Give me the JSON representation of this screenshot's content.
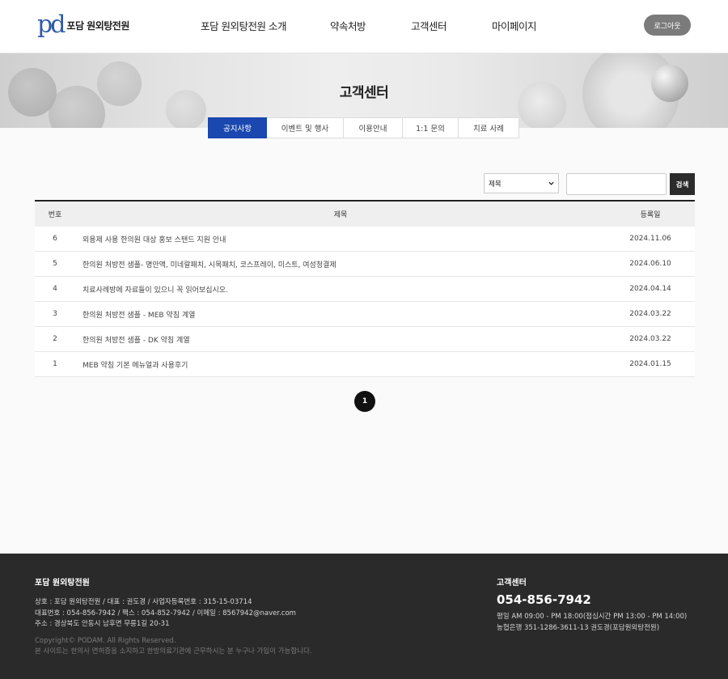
{
  "header": {
    "logo_mark": "pd",
    "logo_text": "포담 원외탕전원",
    "nav": [
      {
        "label": "포담 원외탕전원 소개"
      },
      {
        "label": "약속처방"
      },
      {
        "label": "고객센터"
      },
      {
        "label": "마이페이지"
      }
    ],
    "logout_label": "로그아웃"
  },
  "banner": {
    "title": "고객센터"
  },
  "subtabs": [
    {
      "label": "공지사항",
      "active": true
    },
    {
      "label": "이벤트 및 행사",
      "active": false
    },
    {
      "label": "이용안내",
      "active": false
    },
    {
      "label": "1:1 문의",
      "active": false
    },
    {
      "label": "치료 사례",
      "active": false
    }
  ],
  "search": {
    "select_value": "제목",
    "input_value": "",
    "button_label": "검색"
  },
  "board": {
    "columns": {
      "no": "번호",
      "title": "제목",
      "date": "등록일"
    },
    "rows": [
      {
        "no": "6",
        "title": "외용제 사용 한의원 대상 홍보 스탠드 지원 안내",
        "date": "2024.11.06"
      },
      {
        "no": "5",
        "title": "한의원 처방전 샘플- 명안액, 미네랄패치, 시목패치, 코스프레이, 미스트, 여성청결제",
        "date": "2024.06.10"
      },
      {
        "no": "4",
        "title": "치료사례방에 자료들이 있으니 꼭 읽어보십시오.",
        "date": "2024.04.14"
      },
      {
        "no": "3",
        "title": "한의원 처방전 샘플 - MEB 약침 계열",
        "date": "2024.03.22"
      },
      {
        "no": "2",
        "title": "한의원 처방전 샘플 - DK 약침 계열",
        "date": "2024.03.22"
      },
      {
        "no": "1",
        "title": "MEB 약침 기본 메뉴얼과 사용후기",
        "date": "2024.01.15"
      }
    ]
  },
  "pagination": {
    "current": "1"
  },
  "footer": {
    "company_name": "포담 원외탕전원",
    "info_lines": [
      "상호 : 포담 원외탕전원 / 대표 : 권도경 / 사업자등록번호 : 315-15-03714",
      "대표번호 : 054-856-7942 / 팩스 : 054-852-7942 / 이메일 : 8567942@naver.com",
      "주소 : 경상북도 안동시 남후면 무릉1길 20-31"
    ],
    "copyright": "Copyright© PODAM. All Rights Reserved.",
    "notice": "본 사이트는 한의사 면허증을 소지하고 한방의료기관에 근무하시는 분 누구나 가입이 가능합니다.",
    "cs_title": "고객센터",
    "cs_phone": "054-856-7942",
    "cs_hours": "평일 AM 09:00 - PM 18:00(점심시간 PM 13:00 - PM 14:00)",
    "cs_bank": "농협은행 351-1286-3611-13 권도경(포담원외탕전원)"
  },
  "colors": {
    "accent": "#1a47b0",
    "logo": "#2f5aa8",
    "footer_bg": "#2a2a2a",
    "logout_bg": "#7b7b7b"
  },
  "icons": {
    "select_chevron": "chevron-down-icon"
  }
}
